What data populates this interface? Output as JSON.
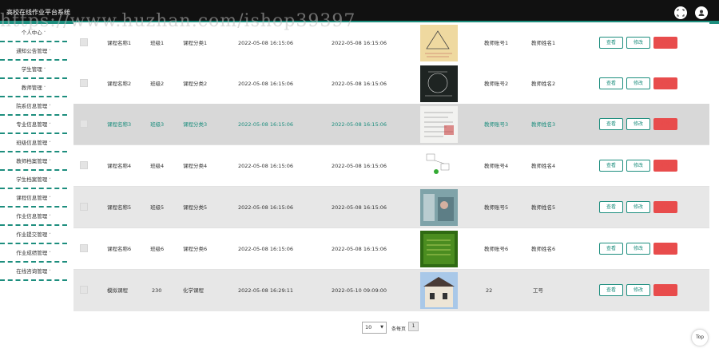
{
  "header": {
    "title": "高校在线作业平台系统",
    "accent_color": "#1d8e7e",
    "fullscreen_icon": "expand-icon",
    "user_icon": "user-icon"
  },
  "watermark": "https://www.huzhan.com/ishop39397",
  "sidebar": {
    "items": [
      {
        "label": "个人中心"
      },
      {
        "label": "通知公告管理"
      },
      {
        "label": "学生管理"
      },
      {
        "label": "教师管理"
      },
      {
        "label": "院系信息管理"
      },
      {
        "label": "专业信息管理"
      },
      {
        "label": "班级信息管理"
      },
      {
        "label": "教师档案管理"
      },
      {
        "label": "学生档案管理"
      },
      {
        "label": "课程信息管理"
      },
      {
        "label": "作业信息管理"
      },
      {
        "label": "作业提交管理"
      },
      {
        "label": "作业成绩管理"
      },
      {
        "label": "在线咨询管理"
      }
    ],
    "caret": "˅"
  },
  "actions": {
    "view": "查看",
    "edit": "修改",
    "delete": "删除"
  },
  "rows": [
    {
      "name": "课程名称1",
      "class": "班级1",
      "category": "课程分类1",
      "start": "2022-05-08 16:15:06",
      "end": "2022-05-08 16:15:06",
      "teacher_no": "教师账号1",
      "teacher_name": "教师姓名1",
      "thumb": "math-notes"
    },
    {
      "name": "课程名称2",
      "class": "班级2",
      "category": "课程分类2",
      "start": "2022-05-08 16:15:06",
      "end": "2022-05-08 16:15:06",
      "teacher_no": "教师账号2",
      "teacher_name": "教师姓名2",
      "thumb": "blackboard"
    },
    {
      "name": "课程名称3",
      "class": "班级3",
      "category": "课程分类3",
      "start": "2022-05-08 16:15:06",
      "end": "2022-05-08 16:15:06",
      "teacher_no": "教师账号3",
      "teacher_name": "教师姓名3",
      "thumb": "worksheet"
    },
    {
      "name": "课程名称4",
      "class": "班级4",
      "category": "课程分类4",
      "start": "2022-05-08 16:15:06",
      "end": "2022-05-08 16:15:06",
      "teacher_no": "教师账号4",
      "teacher_name": "教师姓名4",
      "thumb": "diagram"
    },
    {
      "name": "课程名称5",
      "class": "班级5",
      "category": "课程分类5",
      "start": "2022-05-08 16:15:06",
      "end": "2022-05-08 16:15:06",
      "teacher_no": "教师账号5",
      "teacher_name": "教师姓名5",
      "thumb": "lab-photo"
    },
    {
      "name": "课程名称6",
      "class": "班级6",
      "category": "课程分类6",
      "start": "2022-05-08 16:15:06",
      "end": "2022-05-08 16:15:06",
      "teacher_no": "教师账号6",
      "teacher_name": "教师姓名6",
      "thumb": "green-board"
    },
    {
      "name": "模拟课程",
      "class": "230",
      "category": "化学课程",
      "start": "2022-05-08 16:29:11",
      "end": "2022-05-10 09:09:00",
      "teacher_no": "22",
      "teacher_name": "工号",
      "thumb": "building"
    }
  ],
  "pager": {
    "page_size": "10",
    "total_label": "条每页",
    "current_page": "1"
  },
  "back_to_top": "Top"
}
